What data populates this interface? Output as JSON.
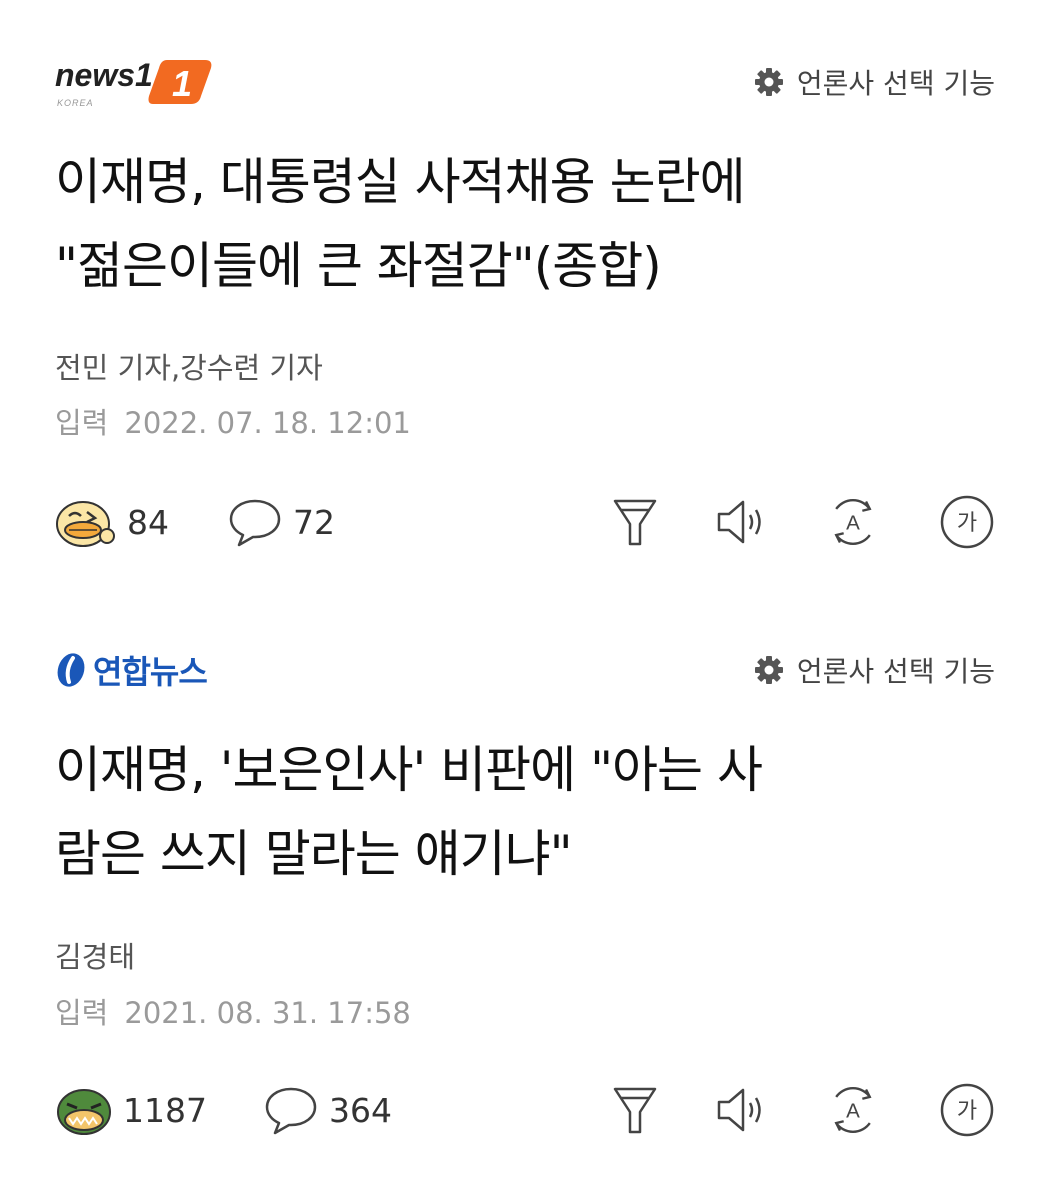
{
  "articles": [
    {
      "publisher": "news1",
      "publisher_sub": "KOREA",
      "press_select_label": "언론사 선택 기능",
      "headline_line1": "이재명, 대통령실 사적채용 논란에",
      "headline_line2": "\"젊은이들에 큰 좌절감\"(종합)",
      "reporters": "전민 기자,강수련 기자",
      "date_label": "입력",
      "date": "2022. 07. 18. 12:01",
      "reaction_count": "84",
      "comment_count": "72"
    },
    {
      "publisher": "연합뉴스",
      "press_select_label": "언론사 선택 기능",
      "headline_line1": "이재명, '보은인사' 비판에 \"아는 사",
      "headline_line2": "람은 쓰지 말라는 얘기냐\"",
      "reporters": "김경태",
      "date_label": "입력",
      "date": "2021. 08. 31. 17:58",
      "reaction_count": "1187",
      "comment_count": "364"
    }
  ],
  "icons": {
    "gear": "gear-icon",
    "reaction": "emoji-reaction-icon",
    "comment": "speech-bubble-icon",
    "summary": "funnel-summary-icon",
    "speaker": "speaker-tts-icon",
    "translate": "translate-a-icon",
    "font": "font-size-ga-icon"
  },
  "colors": {
    "news1_orange": "#f26a21",
    "yonhap_blue": "#1a57b8",
    "text_gray": "#555555",
    "date_gray": "#9a9a9a"
  }
}
